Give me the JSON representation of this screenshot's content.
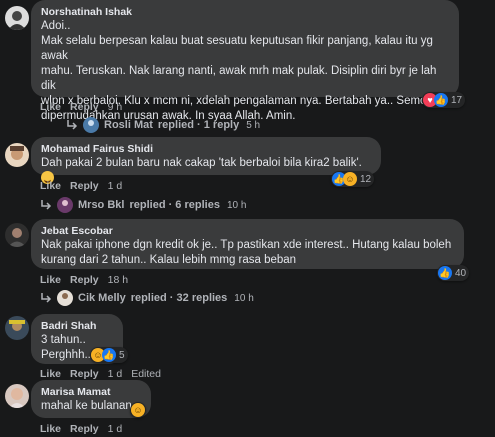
{
  "comments": [
    {
      "name": "Norshatinah Ishak",
      "lines": [
        "Adoi..",
        "Mak selalu berpesan kalau buat sesuatu keputusan fikir panjang, kalau itu yg awak",
        "mahu. Teruskan. Nak larang nanti, awak mrh mak pulak. Disiplin diri byr je lah dik",
        "wlpn x berbaloi. Klu x mcm ni, xdelah pengalaman nya. Bertabah ya.. Semoga",
        "dipermudahkan urusan awak. In syaa Allah. Amin."
      ],
      "like": "Like",
      "reply": "Reply",
      "time": "9 h",
      "reaction_count": "17",
      "reactions": [
        "love",
        "like"
      ],
      "replies": {
        "name": "Rosli Mat",
        "text": "replied · 1 reply",
        "time": "5 h"
      }
    },
    {
      "name": "Mohamad Fairus Shidi",
      "lines": [
        "Dah pakai 2 bulan baru nak cakap 'tak berbaloi bila kira2 balik'."
      ],
      "like": "Like",
      "reply": "Reply",
      "time": "1 d",
      "reaction_count": "12",
      "reactions": [
        "like",
        "haha"
      ],
      "replies": {
        "name": "Mrso Bkl",
        "text": "replied · 6 replies",
        "time": "10 h"
      }
    },
    {
      "name": "Jebat Escobar",
      "lines": [
        "Nak pakai iphone dgn kredit ok je.. Tp pastikan xde interest.. Hutang kalau boleh",
        "kurang dari 2 tahun.. Kalau lebih mmg rasa beban"
      ],
      "like": "Like",
      "reply": "Reply",
      "time": "18 h",
      "reaction_count": "40",
      "reactions": [
        "like"
      ],
      "replies": {
        "name": "Cik Melly",
        "text": "replied · 32 replies",
        "time": "10 h"
      }
    },
    {
      "name": "Badri Shah",
      "lines": [
        "3 tahun..",
        "Perghhh...."
      ],
      "like": "Like",
      "reply": "Reply",
      "time": "1 d",
      "edited": "Edited",
      "reaction_count": "5",
      "reactions": [
        "haha",
        "like"
      ]
    },
    {
      "name": "Marisa Mamat",
      "lines": [
        "mahal ke bulanan"
      ],
      "like": "Like",
      "reply": "Reply",
      "time": "1 d",
      "reactions": [
        "haha"
      ]
    }
  ],
  "colors": {
    "background": "#18191a",
    "bubble": "#3a3b3c",
    "like": "#1877f2",
    "love": "#f33e58",
    "haha": "#f7b125"
  }
}
